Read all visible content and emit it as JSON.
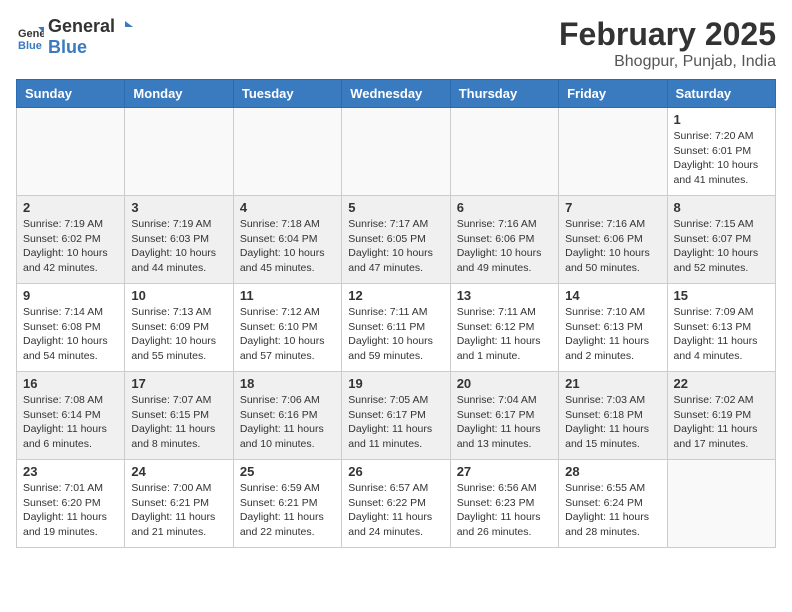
{
  "header": {
    "logo_general": "General",
    "logo_blue": "Blue",
    "month_year": "February 2025",
    "location": "Bhogpur, Punjab, India"
  },
  "weekdays": [
    "Sunday",
    "Monday",
    "Tuesday",
    "Wednesday",
    "Thursday",
    "Friday",
    "Saturday"
  ],
  "weeks": [
    [
      {
        "day": "",
        "info": ""
      },
      {
        "day": "",
        "info": ""
      },
      {
        "day": "",
        "info": ""
      },
      {
        "day": "",
        "info": ""
      },
      {
        "day": "",
        "info": ""
      },
      {
        "day": "",
        "info": ""
      },
      {
        "day": "1",
        "info": "Sunrise: 7:20 AM\nSunset: 6:01 PM\nDaylight: 10 hours\nand 41 minutes."
      }
    ],
    [
      {
        "day": "2",
        "info": "Sunrise: 7:19 AM\nSunset: 6:02 PM\nDaylight: 10 hours\nand 42 minutes."
      },
      {
        "day": "3",
        "info": "Sunrise: 7:19 AM\nSunset: 6:03 PM\nDaylight: 10 hours\nand 44 minutes."
      },
      {
        "day": "4",
        "info": "Sunrise: 7:18 AM\nSunset: 6:04 PM\nDaylight: 10 hours\nand 45 minutes."
      },
      {
        "day": "5",
        "info": "Sunrise: 7:17 AM\nSunset: 6:05 PM\nDaylight: 10 hours\nand 47 minutes."
      },
      {
        "day": "6",
        "info": "Sunrise: 7:16 AM\nSunset: 6:06 PM\nDaylight: 10 hours\nand 49 minutes."
      },
      {
        "day": "7",
        "info": "Sunrise: 7:16 AM\nSunset: 6:06 PM\nDaylight: 10 hours\nand 50 minutes."
      },
      {
        "day": "8",
        "info": "Sunrise: 7:15 AM\nSunset: 6:07 PM\nDaylight: 10 hours\nand 52 minutes."
      }
    ],
    [
      {
        "day": "9",
        "info": "Sunrise: 7:14 AM\nSunset: 6:08 PM\nDaylight: 10 hours\nand 54 minutes."
      },
      {
        "day": "10",
        "info": "Sunrise: 7:13 AM\nSunset: 6:09 PM\nDaylight: 10 hours\nand 55 minutes."
      },
      {
        "day": "11",
        "info": "Sunrise: 7:12 AM\nSunset: 6:10 PM\nDaylight: 10 hours\nand 57 minutes."
      },
      {
        "day": "12",
        "info": "Sunrise: 7:11 AM\nSunset: 6:11 PM\nDaylight: 10 hours\nand 59 minutes."
      },
      {
        "day": "13",
        "info": "Sunrise: 7:11 AM\nSunset: 6:12 PM\nDaylight: 11 hours\nand 1 minute."
      },
      {
        "day": "14",
        "info": "Sunrise: 7:10 AM\nSunset: 6:13 PM\nDaylight: 11 hours\nand 2 minutes."
      },
      {
        "day": "15",
        "info": "Sunrise: 7:09 AM\nSunset: 6:13 PM\nDaylight: 11 hours\nand 4 minutes."
      }
    ],
    [
      {
        "day": "16",
        "info": "Sunrise: 7:08 AM\nSunset: 6:14 PM\nDaylight: 11 hours\nand 6 minutes."
      },
      {
        "day": "17",
        "info": "Sunrise: 7:07 AM\nSunset: 6:15 PM\nDaylight: 11 hours\nand 8 minutes."
      },
      {
        "day": "18",
        "info": "Sunrise: 7:06 AM\nSunset: 6:16 PM\nDaylight: 11 hours\nand 10 minutes."
      },
      {
        "day": "19",
        "info": "Sunrise: 7:05 AM\nSunset: 6:17 PM\nDaylight: 11 hours\nand 11 minutes."
      },
      {
        "day": "20",
        "info": "Sunrise: 7:04 AM\nSunset: 6:17 PM\nDaylight: 11 hours\nand 13 minutes."
      },
      {
        "day": "21",
        "info": "Sunrise: 7:03 AM\nSunset: 6:18 PM\nDaylight: 11 hours\nand 15 minutes."
      },
      {
        "day": "22",
        "info": "Sunrise: 7:02 AM\nSunset: 6:19 PM\nDaylight: 11 hours\nand 17 minutes."
      }
    ],
    [
      {
        "day": "23",
        "info": "Sunrise: 7:01 AM\nSunset: 6:20 PM\nDaylight: 11 hours\nand 19 minutes."
      },
      {
        "day": "24",
        "info": "Sunrise: 7:00 AM\nSunset: 6:21 PM\nDaylight: 11 hours\nand 21 minutes."
      },
      {
        "day": "25",
        "info": "Sunrise: 6:59 AM\nSunset: 6:21 PM\nDaylight: 11 hours\nand 22 minutes."
      },
      {
        "day": "26",
        "info": "Sunrise: 6:57 AM\nSunset: 6:22 PM\nDaylight: 11 hours\nand 24 minutes."
      },
      {
        "day": "27",
        "info": "Sunrise: 6:56 AM\nSunset: 6:23 PM\nDaylight: 11 hours\nand 26 minutes."
      },
      {
        "day": "28",
        "info": "Sunrise: 6:55 AM\nSunset: 6:24 PM\nDaylight: 11 hours\nand 28 minutes."
      },
      {
        "day": "",
        "info": ""
      }
    ]
  ]
}
